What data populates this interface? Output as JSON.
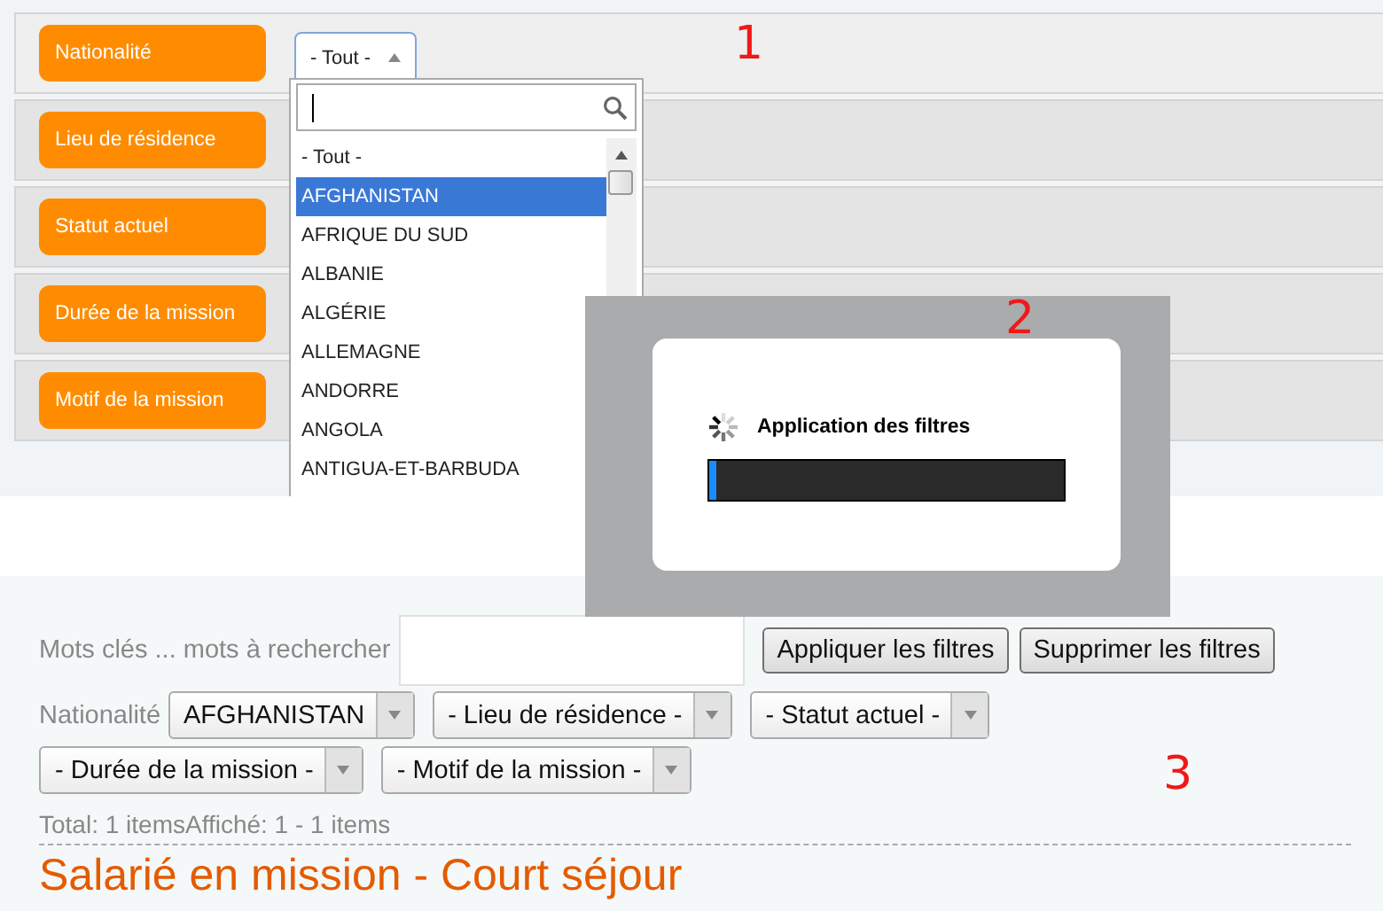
{
  "filter_panel": {
    "filters": [
      {
        "label": "Nationalité",
        "select": {
          "value": "- Tout -",
          "expanded": true
        }
      },
      {
        "label": "Lieu de résidence"
      },
      {
        "label": "Statut actuel"
      },
      {
        "label": "Durée de la mission"
      },
      {
        "label": "Motif de la mission"
      }
    ]
  },
  "dropdown": {
    "options": [
      {
        "label": "- Tout -",
        "selected": false
      },
      {
        "label": "AFGHANISTAN",
        "selected": true
      },
      {
        "label": "AFRIQUE DU SUD",
        "selected": false
      },
      {
        "label": "ALBANIE",
        "selected": false
      },
      {
        "label": "ALGÉRIE",
        "selected": false
      },
      {
        "label": "ALLEMAGNE",
        "selected": false
      },
      {
        "label": "ANDORRE",
        "selected": false
      },
      {
        "label": "ANGOLA",
        "selected": false
      },
      {
        "label": "ANTIGUA-ET-BARBUDA",
        "selected": false
      }
    ]
  },
  "loading_dialog": {
    "message": "Application des filtres",
    "level": 0.02
  },
  "search_form": {
    "keywords_label": "Mots clés ... mots à rechercher",
    "buttons": [
      "Appliquer les filtres",
      "Supprimer les filtres"
    ],
    "filter_label": "Nationalité",
    "selects": [
      {
        "value": "AFGHANISTAN"
      },
      {
        "value": "- Lieu de résidence -"
      },
      {
        "value": "- Statut actuel -"
      },
      {
        "value": "- Durée de la mission -"
      },
      {
        "value": "- Motif de la mission -"
      }
    ],
    "summary": "Total: 1 itemsAffiché: 1 - 1 items",
    "heading": "Salarié en mission - Court séjour"
  },
  "annotations": [
    "1",
    "2",
    "3"
  ]
}
